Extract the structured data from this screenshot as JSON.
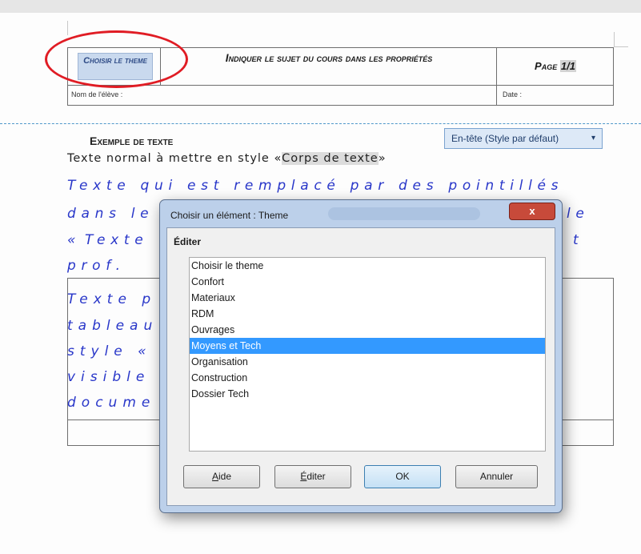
{
  "header_table": {
    "theme_field": "Choisir le theme",
    "subject": "Indiquer le sujet du cours dans les propriétés",
    "page_label": "Page",
    "page_number": "1/1",
    "student_name_label": "Nom de l'élève :",
    "date_label": "Date :"
  },
  "header_tag": {
    "label": "En-tête (Style par défaut)",
    "arrow": "▾"
  },
  "document": {
    "example_title": "Exemple de texte",
    "normal_text_prefix": "Texte normal à mettre en style «",
    "normal_text_field": "Corps de texte",
    "normal_text_suffix": "»",
    "blue_lines": [
      "Texte qui est remplacé par des pointillés",
      "dans le",
      "«",
      "Texte",
      "prof."
    ],
    "blue_right_fragments": [
      "le",
      "t"
    ],
    "box_lines": [
      "Texte p",
      "tableau",
      "style «",
      "visible",
      "docume"
    ]
  },
  "dialog": {
    "title": "Choisir un élément : Theme",
    "close_glyph": "x",
    "group_label": "Éditer",
    "items": [
      "Choisir le theme",
      "Confort",
      "Materiaux",
      "RDM",
      "Ouvrages",
      "Moyens et Tech",
      "Organisation",
      "Construction",
      "Dossier Tech"
    ],
    "selected_index": 5,
    "buttons": {
      "help_mnemonic": "A",
      "help_rest": "ide",
      "edit_mnemonic": "É",
      "edit_rest": "diter",
      "ok": "OK",
      "cancel": "Annuler"
    }
  },
  "colors": {
    "annotation_oval": "#e01c24",
    "selection": "#3399ff",
    "blue_text": "#2836c9"
  }
}
